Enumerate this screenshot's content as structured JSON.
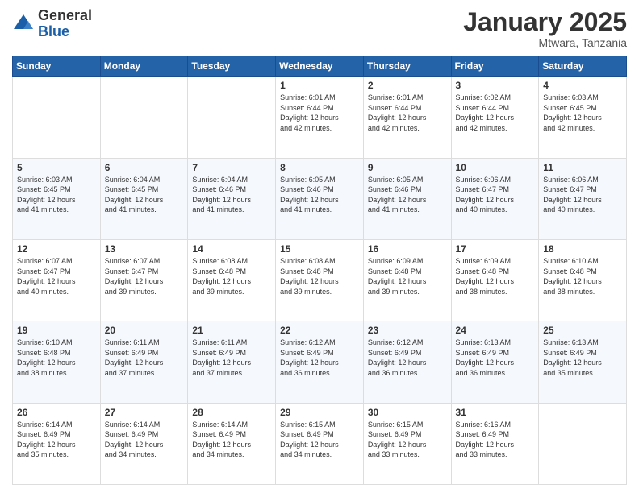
{
  "logo": {
    "general": "General",
    "blue": "Blue"
  },
  "header": {
    "month": "January 2025",
    "location": "Mtwara, Tanzania"
  },
  "days_of_week": [
    "Sunday",
    "Monday",
    "Tuesday",
    "Wednesday",
    "Thursday",
    "Friday",
    "Saturday"
  ],
  "weeks": [
    [
      {
        "day": "",
        "info": ""
      },
      {
        "day": "",
        "info": ""
      },
      {
        "day": "",
        "info": ""
      },
      {
        "day": "1",
        "info": "Sunrise: 6:01 AM\nSunset: 6:44 PM\nDaylight: 12 hours\nand 42 minutes."
      },
      {
        "day": "2",
        "info": "Sunrise: 6:01 AM\nSunset: 6:44 PM\nDaylight: 12 hours\nand 42 minutes."
      },
      {
        "day": "3",
        "info": "Sunrise: 6:02 AM\nSunset: 6:44 PM\nDaylight: 12 hours\nand 42 minutes."
      },
      {
        "day": "4",
        "info": "Sunrise: 6:03 AM\nSunset: 6:45 PM\nDaylight: 12 hours\nand 42 minutes."
      }
    ],
    [
      {
        "day": "5",
        "info": "Sunrise: 6:03 AM\nSunset: 6:45 PM\nDaylight: 12 hours\nand 41 minutes."
      },
      {
        "day": "6",
        "info": "Sunrise: 6:04 AM\nSunset: 6:45 PM\nDaylight: 12 hours\nand 41 minutes."
      },
      {
        "day": "7",
        "info": "Sunrise: 6:04 AM\nSunset: 6:46 PM\nDaylight: 12 hours\nand 41 minutes."
      },
      {
        "day": "8",
        "info": "Sunrise: 6:05 AM\nSunset: 6:46 PM\nDaylight: 12 hours\nand 41 minutes."
      },
      {
        "day": "9",
        "info": "Sunrise: 6:05 AM\nSunset: 6:46 PM\nDaylight: 12 hours\nand 41 minutes."
      },
      {
        "day": "10",
        "info": "Sunrise: 6:06 AM\nSunset: 6:47 PM\nDaylight: 12 hours\nand 40 minutes."
      },
      {
        "day": "11",
        "info": "Sunrise: 6:06 AM\nSunset: 6:47 PM\nDaylight: 12 hours\nand 40 minutes."
      }
    ],
    [
      {
        "day": "12",
        "info": "Sunrise: 6:07 AM\nSunset: 6:47 PM\nDaylight: 12 hours\nand 40 minutes."
      },
      {
        "day": "13",
        "info": "Sunrise: 6:07 AM\nSunset: 6:47 PM\nDaylight: 12 hours\nand 39 minutes."
      },
      {
        "day": "14",
        "info": "Sunrise: 6:08 AM\nSunset: 6:48 PM\nDaylight: 12 hours\nand 39 minutes."
      },
      {
        "day": "15",
        "info": "Sunrise: 6:08 AM\nSunset: 6:48 PM\nDaylight: 12 hours\nand 39 minutes."
      },
      {
        "day": "16",
        "info": "Sunrise: 6:09 AM\nSunset: 6:48 PM\nDaylight: 12 hours\nand 39 minutes."
      },
      {
        "day": "17",
        "info": "Sunrise: 6:09 AM\nSunset: 6:48 PM\nDaylight: 12 hours\nand 38 minutes."
      },
      {
        "day": "18",
        "info": "Sunrise: 6:10 AM\nSunset: 6:48 PM\nDaylight: 12 hours\nand 38 minutes."
      }
    ],
    [
      {
        "day": "19",
        "info": "Sunrise: 6:10 AM\nSunset: 6:48 PM\nDaylight: 12 hours\nand 38 minutes."
      },
      {
        "day": "20",
        "info": "Sunrise: 6:11 AM\nSunset: 6:49 PM\nDaylight: 12 hours\nand 37 minutes."
      },
      {
        "day": "21",
        "info": "Sunrise: 6:11 AM\nSunset: 6:49 PM\nDaylight: 12 hours\nand 37 minutes."
      },
      {
        "day": "22",
        "info": "Sunrise: 6:12 AM\nSunset: 6:49 PM\nDaylight: 12 hours\nand 36 minutes."
      },
      {
        "day": "23",
        "info": "Sunrise: 6:12 AM\nSunset: 6:49 PM\nDaylight: 12 hours\nand 36 minutes."
      },
      {
        "day": "24",
        "info": "Sunrise: 6:13 AM\nSunset: 6:49 PM\nDaylight: 12 hours\nand 36 minutes."
      },
      {
        "day": "25",
        "info": "Sunrise: 6:13 AM\nSunset: 6:49 PM\nDaylight: 12 hours\nand 35 minutes."
      }
    ],
    [
      {
        "day": "26",
        "info": "Sunrise: 6:14 AM\nSunset: 6:49 PM\nDaylight: 12 hours\nand 35 minutes."
      },
      {
        "day": "27",
        "info": "Sunrise: 6:14 AM\nSunset: 6:49 PM\nDaylight: 12 hours\nand 34 minutes."
      },
      {
        "day": "28",
        "info": "Sunrise: 6:14 AM\nSunset: 6:49 PM\nDaylight: 12 hours\nand 34 minutes."
      },
      {
        "day": "29",
        "info": "Sunrise: 6:15 AM\nSunset: 6:49 PM\nDaylight: 12 hours\nand 34 minutes."
      },
      {
        "day": "30",
        "info": "Sunrise: 6:15 AM\nSunset: 6:49 PM\nDaylight: 12 hours\nand 33 minutes."
      },
      {
        "day": "31",
        "info": "Sunrise: 6:16 AM\nSunset: 6:49 PM\nDaylight: 12 hours\nand 33 minutes."
      },
      {
        "day": "",
        "info": ""
      }
    ]
  ]
}
